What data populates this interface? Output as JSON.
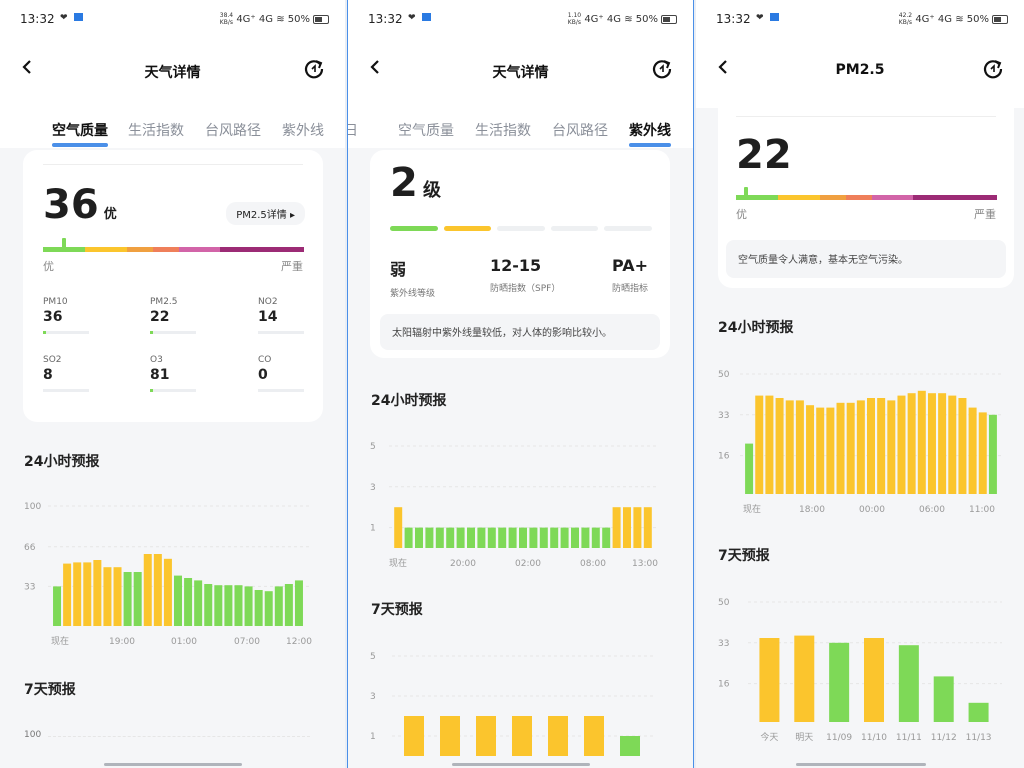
{
  "colors": {
    "good": "#7ed957",
    "moderate": "#fbc52d",
    "accent": "#4a8fe8"
  },
  "panels": [
    {
      "status": {
        "time": "13:32",
        "net_top": "38.4",
        "net_bot": "KB/s",
        "sig": "4G⁺ 4G",
        "battery": "50%"
      },
      "title": "天气详情",
      "tabs": [
        "空气质量",
        "生活指数",
        "台风路径",
        "紫外线"
      ],
      "active_tab": 0,
      "aqi": {
        "value": "36",
        "level": "优",
        "detail_button": "PM2.5详情 ▸",
        "scale_left": "优",
        "scale_right": "严重",
        "marker": 0.07
      },
      "pollutants": [
        {
          "name": "PM10",
          "value": "36"
        },
        {
          "name": "PM2.5",
          "value": "22"
        },
        {
          "name": "NO2",
          "value": "14"
        },
        {
          "name": "SO2",
          "value": "8"
        },
        {
          "name": "O3",
          "value": "81"
        },
        {
          "name": "CO",
          "value": "0"
        }
      ],
      "forecast24_title": "24小时预报",
      "forecast7_title": "7天预报",
      "forecast7_ytop": "100"
    },
    {
      "status": {
        "time": "13:32",
        "net_top": "1.10",
        "net_bot": "KB/s",
        "sig": "4G⁺ 4G",
        "battery": "50%"
      },
      "title": "天气详情",
      "tabs": [
        "日",
        "空气质量",
        "生活指数",
        "台风路径",
        "紫外线"
      ],
      "active_tab": 4,
      "uv": {
        "level_num": "2",
        "level_unit": "级",
        "items": [
          {
            "value": "弱",
            "label": "紫外线等级"
          },
          {
            "value": "12-15",
            "label": "防晒指数（SPF）"
          },
          {
            "value": "PA+",
            "label": "防晒指标"
          }
        ],
        "note": "太阳辐射中紫外线量较低，对人体的影响比较小。"
      },
      "forecast24_title": "24小时预报",
      "forecast7_title": "7天预报"
    },
    {
      "status": {
        "time": "13:32",
        "net_top": "42.2",
        "net_bot": "KB/s",
        "sig": "4G⁺ 4G",
        "battery": "50%"
      },
      "title": "PM2.5",
      "pm": {
        "value": "22",
        "scale_left": "优",
        "scale_right": "严重",
        "note": "空气质量令人满意，基本无空气污染。",
        "marker": 0.03
      },
      "forecast24_title": "24小时预报",
      "forecast7_title": "7天预报"
    }
  ],
  "chart_data": [
    {
      "type": "bar",
      "ylim": [
        0,
        100
      ],
      "yticks": [
        100,
        66,
        33
      ],
      "xtick_labels": [
        "现在",
        "19:00",
        "01:00",
        "07:00",
        "12:00"
      ],
      "values": [
        33,
        52,
        53,
        53,
        55,
        49,
        49,
        45,
        45,
        60,
        60,
        56,
        42,
        40,
        38,
        35,
        34,
        34,
        34,
        33,
        30,
        29,
        33,
        35,
        38
      ],
      "colors": [
        "g",
        "y",
        "y",
        "y",
        "y",
        "y",
        "y",
        "g",
        "g",
        "y",
        "y",
        "y",
        "g",
        "g",
        "g",
        "g",
        "g",
        "g",
        "g",
        "g",
        "g",
        "g",
        "g",
        "g",
        "g"
      ]
    },
    {
      "type": "bar",
      "ylim": [
        0,
        5
      ],
      "yticks": [
        5,
        3,
        1
      ],
      "xtick_labels": [
        "现在",
        "20:00",
        "02:00",
        "08:00",
        "13:00"
      ],
      "values": [
        2,
        1,
        1,
        1,
        1,
        1,
        1,
        1,
        1,
        1,
        1,
        1,
        1,
        1,
        1,
        1,
        1,
        1,
        1,
        1,
        1,
        2,
        2,
        2,
        2
      ],
      "colors": [
        "y",
        "g",
        "g",
        "g",
        "g",
        "g",
        "g",
        "g",
        "g",
        "g",
        "g",
        "g",
        "g",
        "g",
        "g",
        "g",
        "g",
        "g",
        "g",
        "g",
        "g",
        "y",
        "y",
        "y",
        "y"
      ]
    },
    {
      "type": "bar",
      "ylim": [
        0,
        5
      ],
      "yticks": [
        5,
        3,
        1
      ],
      "xtick_labels": [],
      "values": [
        2,
        2,
        2,
        2,
        2,
        2,
        1
      ],
      "colors": [
        "y",
        "y",
        "y",
        "y",
        "y",
        "y",
        "g"
      ]
    },
    {
      "type": "bar",
      "ylim": [
        0,
        50
      ],
      "yticks": [
        50,
        33,
        16
      ],
      "xtick_labels": [
        "现在",
        "18:00",
        "00:00",
        "06:00",
        "11:00"
      ],
      "values": [
        21,
        41,
        41,
        40,
        39,
        39,
        37,
        36,
        36,
        38,
        38,
        39,
        40,
        40,
        39,
        41,
        42,
        43,
        42,
        42,
        41,
        40,
        36,
        34,
        33
      ],
      "colors": [
        "g",
        "y",
        "y",
        "y",
        "y",
        "y",
        "y",
        "y",
        "y",
        "y",
        "y",
        "y",
        "y",
        "y",
        "y",
        "y",
        "y",
        "y",
        "y",
        "y",
        "y",
        "y",
        "y",
        "y",
        "g"
      ]
    },
    {
      "type": "bar",
      "ylim": [
        0,
        50
      ],
      "yticks": [
        50,
        33,
        16
      ],
      "xtick_labels": [
        "今天",
        "明天",
        "11/09",
        "11/10",
        "11/11",
        "11/12",
        "11/13"
      ],
      "values": [
        35,
        36,
        33,
        35,
        32,
        19,
        8
      ],
      "colors": [
        "y",
        "y",
        "g",
        "y",
        "g",
        "g",
        "g"
      ]
    }
  ]
}
